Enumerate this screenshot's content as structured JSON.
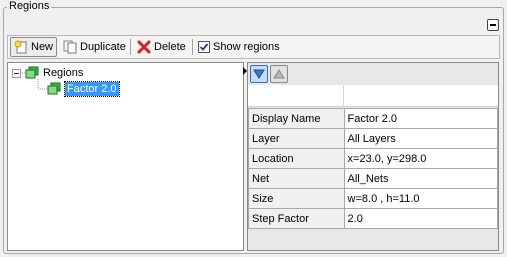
{
  "panel": {
    "title": "Regions"
  },
  "toolbar": {
    "new_label": "New",
    "duplicate_label": "Duplicate",
    "delete_label": "Delete",
    "show_regions_label": "Show regions",
    "show_regions_checked": true
  },
  "tree": {
    "root_label": "Regions",
    "children": [
      {
        "label": "Factor 2.0",
        "selected": true
      }
    ]
  },
  "properties": [
    {
      "key": "Display Name",
      "value": "Factor 2.0"
    },
    {
      "key": "Layer",
      "value": "All Layers"
    },
    {
      "key": "Location",
      "value": "x=23.0, y=298.0"
    },
    {
      "key": "Net",
      "value": "All_Nets"
    },
    {
      "key": "Size",
      "value": "w=8.0 , h=11.0"
    },
    {
      "key": "Step Factor",
      "value": "2.0"
    }
  ],
  "icons": {
    "new": "new-document-icon",
    "duplicate": "duplicate-icon",
    "delete": "delete-icon",
    "region": "region-icon",
    "sort_down": "sort-descending-icon",
    "sort_up": "sort-ascending-icon"
  },
  "colors": {
    "selection": "#3399ff",
    "region_icon": "#3cb043",
    "delete": "#d42020"
  }
}
